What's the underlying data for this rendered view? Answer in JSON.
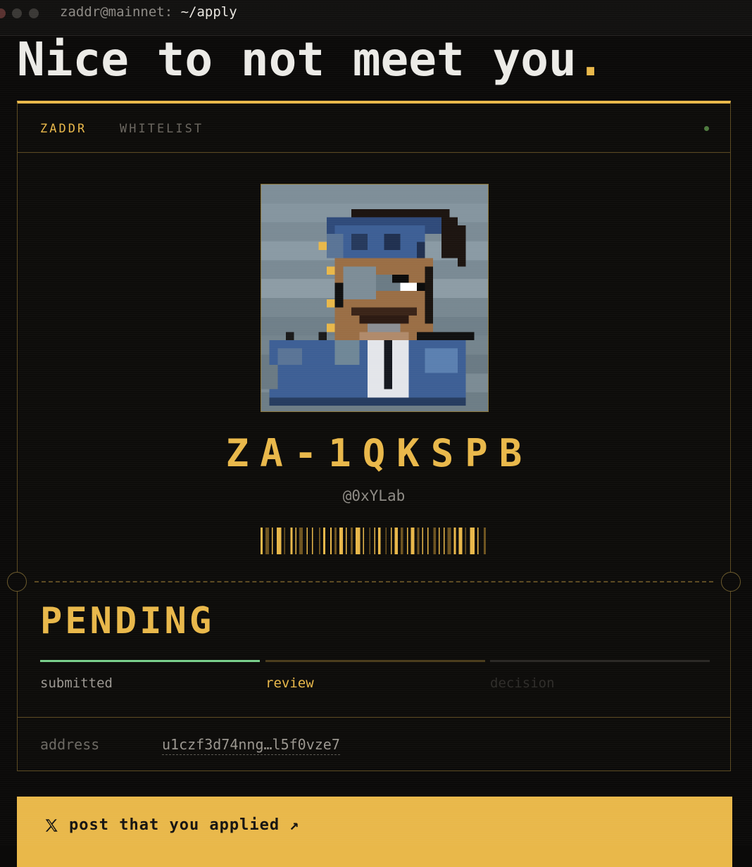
{
  "window": {
    "user_host": "zaddr@mainnet:",
    "path": "~/apply"
  },
  "headline": {
    "text": "Nice to not meet you",
    "accent": "."
  },
  "card": {
    "tabs": [
      {
        "label": "ZADDR",
        "active": true
      },
      {
        "label": "WHITELIST",
        "active": false
      }
    ],
    "live_indicator_color": "#4e7a3e",
    "avatar_icon": "pixel-avatar",
    "user_id": "ZA-1QKSPB",
    "handle": "@0xYLab",
    "status": "PENDING",
    "steps": [
      {
        "label": "submitted",
        "state": "done",
        "color": "#79cf8c"
      },
      {
        "label": "review",
        "state": "current",
        "color": "#e9b84a"
      },
      {
        "label": "decision",
        "state": "pending",
        "color": "#2f2d2a"
      }
    ],
    "address": {
      "label": "address",
      "value": "u1czf3d74nng…l5f0vze7"
    }
  },
  "cta": {
    "icon": "x-logo-icon",
    "label": "post that you applied",
    "arrow": "↗"
  },
  "colors": {
    "accent": "#e9b84a",
    "background": "#0b0a09",
    "success": "#79cf8c"
  }
}
